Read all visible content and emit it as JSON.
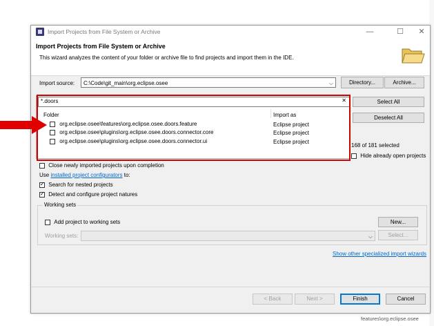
{
  "window": {
    "title": "Import Projects from File System or Archive",
    "controls": {
      "minimize": "—",
      "maximize": "☐",
      "close": "✕"
    }
  },
  "header": {
    "title": "Import Projects from File System or Archive",
    "description": "This wizard analyzes the content of your folder or archive file to find projects and import them in the IDE."
  },
  "source": {
    "label": "Import source:",
    "value": "C:\\Code\\git_main\\org.eclipse.osee",
    "directory_button": "Directory...",
    "archive_button": "Archive..."
  },
  "filter": {
    "value": "*.doors",
    "clear": "✕"
  },
  "table": {
    "headers": [
      "Folder",
      "Import as"
    ],
    "rows": [
      {
        "folder": "org.eclipse.osee\\features\\org.eclipse.osee.doors.feature",
        "import_as": "Eclipse project",
        "checked": false
      },
      {
        "folder": "org.eclipse.osee\\plugins\\org.eclipse.osee.doors.connector.core",
        "import_as": "Eclipse project",
        "checked": false
      },
      {
        "folder": "org.eclipse.osee\\plugins\\org.eclipse.osee.doors.connector.ui",
        "import_as": "Eclipse project",
        "checked": false
      }
    ]
  },
  "side": {
    "select_all": "Select All",
    "deselect_all": "Deselect All",
    "selection_count": "168 of 181 selected",
    "hide_open": "Hide already open projects"
  },
  "options": {
    "close_projects": "Close newly imported projects upon completion",
    "use_prefix": "Use",
    "configurators_link": "installed project configurators",
    "use_suffix": "to:",
    "search_nested": "Search for nested projects",
    "detect_natures": "Detect and configure project natures"
  },
  "working_sets": {
    "group_label": "Working sets",
    "add_to": "Add project to working sets",
    "new_button": "New...",
    "label": "Working sets:",
    "select_button": "Select..."
  },
  "show_wizards_link": "Show other specialized import wizards",
  "footer": {
    "back": "< Back",
    "next": "Next >",
    "finish": "Finish",
    "cancel": "Cancel"
  },
  "background": {
    "fragment": "features\\org.eclipse.osee"
  },
  "colors": {
    "annotation_red": "#d00000",
    "link_blue": "#0066cc",
    "default_button_border": "#0078d7"
  }
}
